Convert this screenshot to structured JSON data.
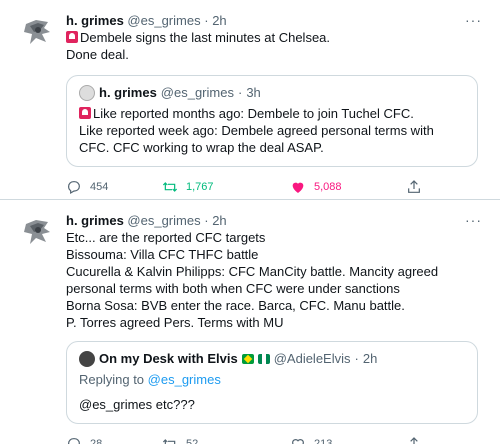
{
  "colors": {
    "accent": "#1d9bf0",
    "retweet": "#00ba7c",
    "like": "#f91880",
    "muted": "#536471",
    "border": "#cfd9de"
  },
  "tweets": [
    {
      "name": "h. grimes",
      "handle": "@es_grimes",
      "time": "2h",
      "text": "Dembele signs the last minutes at Chelsea.\nDone deal.",
      "quote": {
        "name": "h. grimes",
        "handle": "@es_grimes",
        "time": "3h",
        "text": "Like reported months ago: Dembele to join Tuchel CFC.\nLike reported week ago: Dembele agreed personal terms with CFC. CFC working to wrap the deal ASAP."
      },
      "actions": {
        "replies": "454",
        "retweets": "1,767",
        "likes": "5,088"
      }
    },
    {
      "name": "h. grimes",
      "handle": "@es_grimes",
      "time": "2h",
      "text": "Etc... are the reported CFC targets\nBissouma: Villa CFC THFC battle\nCucurella & Kalvin Philipps: CFC ManCity battle. Mancity agreed personal terms with both when CFC were under sanctions\nBorna Sosa: BVB enter the race. Barca, CFC. Manu battle.\nP. Torres agreed Pers. Terms with MU",
      "quote": {
        "name": "On my Desk with Elvis",
        "handle": "@AdieleElvis",
        "time": "2h",
        "replying_label": "Replying to",
        "replying_handle": "@es_grimes",
        "text": "@es_grimes etc???"
      },
      "actions": {
        "replies": "28",
        "retweets": "52",
        "likes": "213"
      }
    }
  ],
  "icons": {
    "more": "more-icon",
    "reply": "reply-icon",
    "retweet": "retweet-icon",
    "like": "heart-icon",
    "share": "share-icon"
  },
  "more_glyph": "···",
  "dot": "·"
}
